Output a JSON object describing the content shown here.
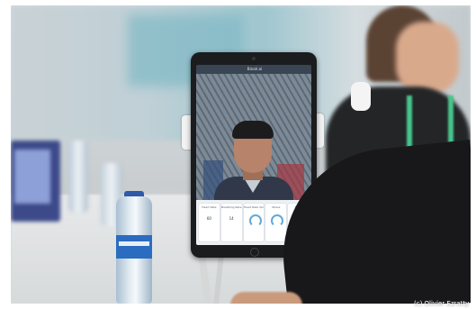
{
  "photo": {
    "credit": "(c) Olivier Ezratty"
  },
  "tablet_app": {
    "header_title": "Binah.ai",
    "metrics": [
      {
        "label": "Heart Rate",
        "value": "60"
      },
      {
        "label": "Breathing Rate",
        "value": "14"
      },
      {
        "label": "Heart Rate Var",
        "value": ""
      },
      {
        "label": "Stress",
        "value": ""
      },
      {
        "label": "SpO2",
        "value": ""
      }
    ]
  },
  "colors": {
    "tablet_frame": "#1b1c1e",
    "gauge": "#62a9d6",
    "lanyard": "#49c48c",
    "bottle_label": "#2a6cc0"
  }
}
